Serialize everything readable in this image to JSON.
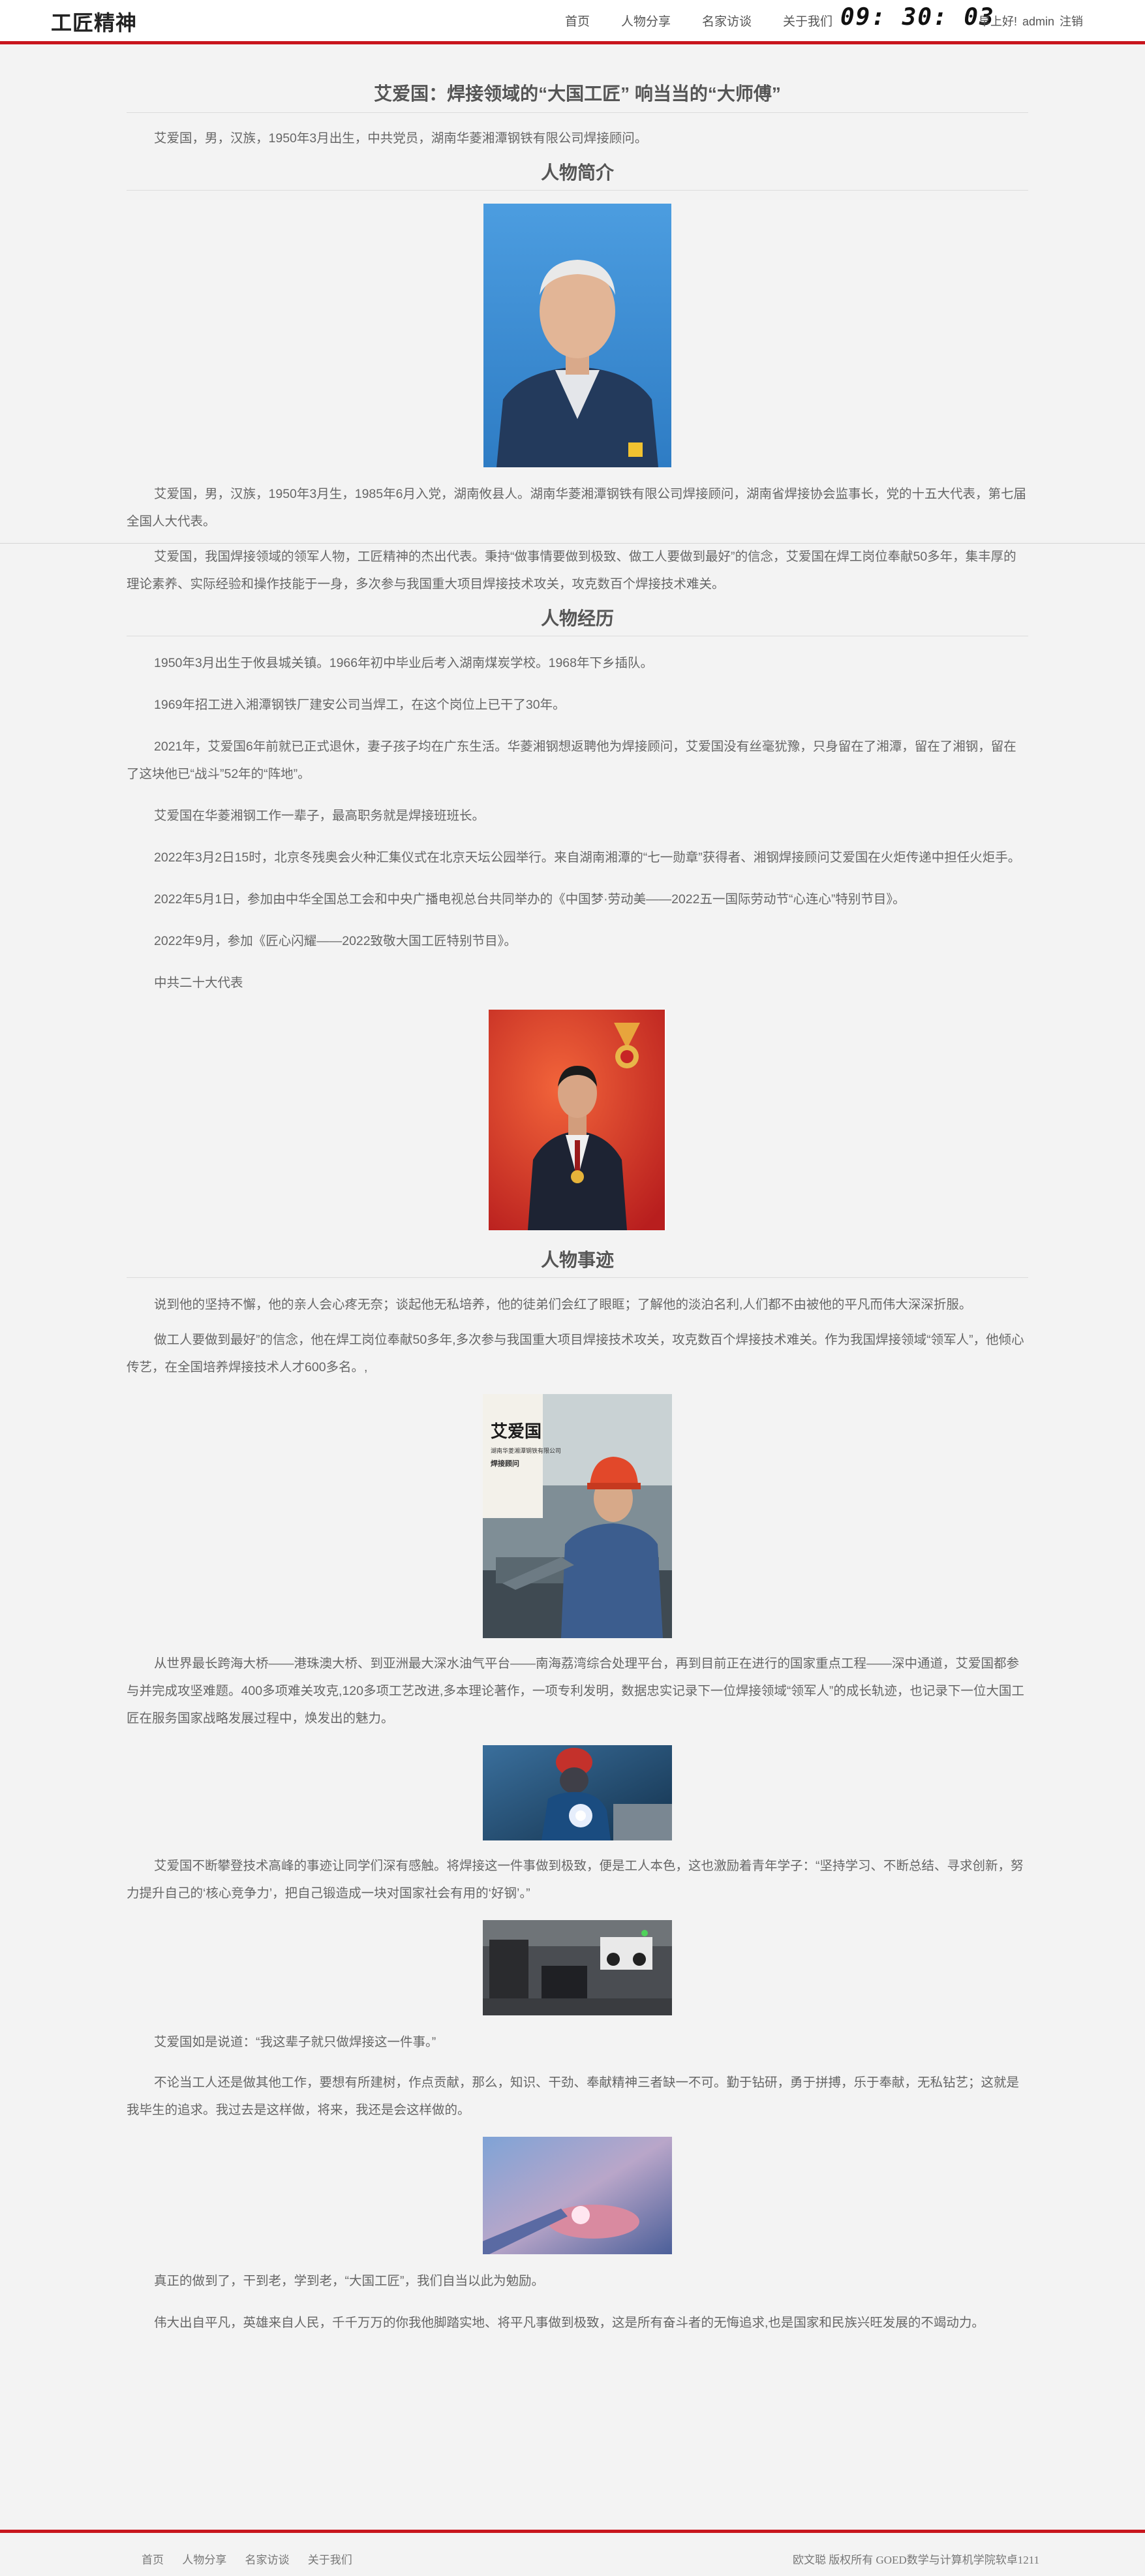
{
  "header": {
    "brand": "工匠精神",
    "nav": [
      "首页",
      "人物分享",
      "名家访谈",
      "关于我们"
    ],
    "clock": "09: 30: 03",
    "greeting": "早上好!",
    "user": "admin",
    "logout": "注销"
  },
  "article": {
    "title": "艾爱国：焊接领域的“大国工匠” 响当当的“大师傅”",
    "intro": "艾爱国，男，汉族，1950年3月出生，中共党员，湖南华菱湘潭钢铁有限公司焊接顾问。",
    "sections": {
      "profile": "人物简介",
      "experience": "人物经历",
      "deeds": "人物事迹"
    },
    "profile_paras": [
      "艾爱国，男，汉族，1950年3月生，1985年6月入党，湖南攸县人。湖南华菱湘潭钢铁有限公司焊接顾问，湖南省焊接协会监事长，党的十五大代表，第七届全国人大代表。",
      "艾爱国，我国焊接领域的领军人物，工匠精神的杰出代表。秉持“做事情要做到极致、做工人要做到最好”的信念，艾爱国在焊工岗位奉献50多年，集丰厚的理论素养、实际经验和操作技能于一身，多次参与我国重大项目焊接技术攻关，攻克数百个焊接技术难关。"
    ],
    "experience_paras": [
      "1950年3月出生于攸县城关镇。1966年初中毕业后考入湖南煤炭学校。1968年下乡插队。",
      "1969年招工进入湘潭钢铁厂建安公司当焊工，在这个岗位上已干了30年。",
      "2021年，艾爱国6年前就已正式退休，妻子孩子均在广东生活。华菱湘钢想返聘他为焊接顾问，艾爱国没有丝毫犹豫，只身留在了湘潭，留在了湘钢，留在了这块他已“战斗”52年的“阵地”。",
      "艾爱国在华菱湘钢工作一辈子，最高职务就是焊接班班长。",
      "2022年3月2日15时，北京冬残奥会火种汇集仪式在北京天坛公园举行。来自湖南湘潭的“七一勋章”获得者、湘钢焊接顾问艾爱国在火炬传递中担任火炬手。",
      "2022年5月1日，参加由中华全国总工会和中央广播电视总台共同举办的《中国梦·劳动美——2022五一国际劳动节“心连心”特别节目》。",
      "2022年9月，参加《匠心闪耀——2022致敬大国工匠特别节目》。",
      "中共二十大代表"
    ],
    "deeds_paras_a": [
      "说到他的坚持不懈，他的亲人会心疼无奈；谈起他无私培养，他的徒弟们会红了眼眶；了解他的淡泊名利,人们都不由被他的平凡而伟大深深折服。",
      "做工人要做到最好”的信念，他在焊工岗位奉献50多年,多次参与我国重大项目焊接技术攻关，攻克数百个焊接技术难关。作为我国焊接领域“领军人”，他倾心传艺，在全国培养焊接技术人才600多名。,"
    ],
    "deeds_para_b": "从世界最长跨海大桥——港珠澳大桥、到亚洲最大深水油气平台——南海荔湾综合处理平台，再到目前正在进行的国家重点工程——深中通道，艾爱国都参与并完成攻坚难题。400多项难关攻克,120多项工艺改进,多本理论著作，一项专利发明，数据忠实记录下一位焊接领域“领军人”的成长轨迹，也记录下一位大国工匠在服务国家战略发展过程中，焕发出的魅力。",
    "deeds_para_c": "艾爱国不断攀登技术高峰的事迹让同学们深有感触。将焊接这一件事做到极致，便是工人本色，这也激励着青年学子：“坚持学习、不断总结、寻求创新，努力提升自己的‘核心竞争力’，把自己锻造成一块对国家社会有用的‘好钢’。”",
    "deeds_paras_d": [
      "艾爱国如是说道：“我这辈子就只做焊接这一件事。”",
      "不论当工人还是做其他工作，要想有所建树，作点贡献，那么，知识、干劲、奉献精神三者缺一不可。勤于钻研，勇于拼搏，乐于奉献，无私钻艺；这就是我毕生的追求。我过去是这样做，将来，我还是会这样做的。"
    ],
    "deeds_paras_e": [
      "真正的做到了，干到老，学到老，“大国工匠”，我们自当以此为勉励。",
      "伟大出自平凡，英雄来自人民，千千万万的你我他脚踏实地、将平凡事做到极致，这是所有奋斗者的无悔追求,也是国家和民族兴旺发展的不竭动力。"
    ],
    "poster_text": {
      "name": "艾爱国",
      "company": "湖南华菱湘潭钢铁有限公司",
      "role": "焊接顾问"
    }
  },
  "footer": {
    "nav": [
      "首页",
      "人物分享",
      "名家访谈",
      "关于我们"
    ],
    "copyright": "欧文聪 版权所有 GOED数学与计算机学院软卓1211"
  },
  "colors": {
    "accent": "#c8161d",
    "background": "#f3f3f3"
  }
}
